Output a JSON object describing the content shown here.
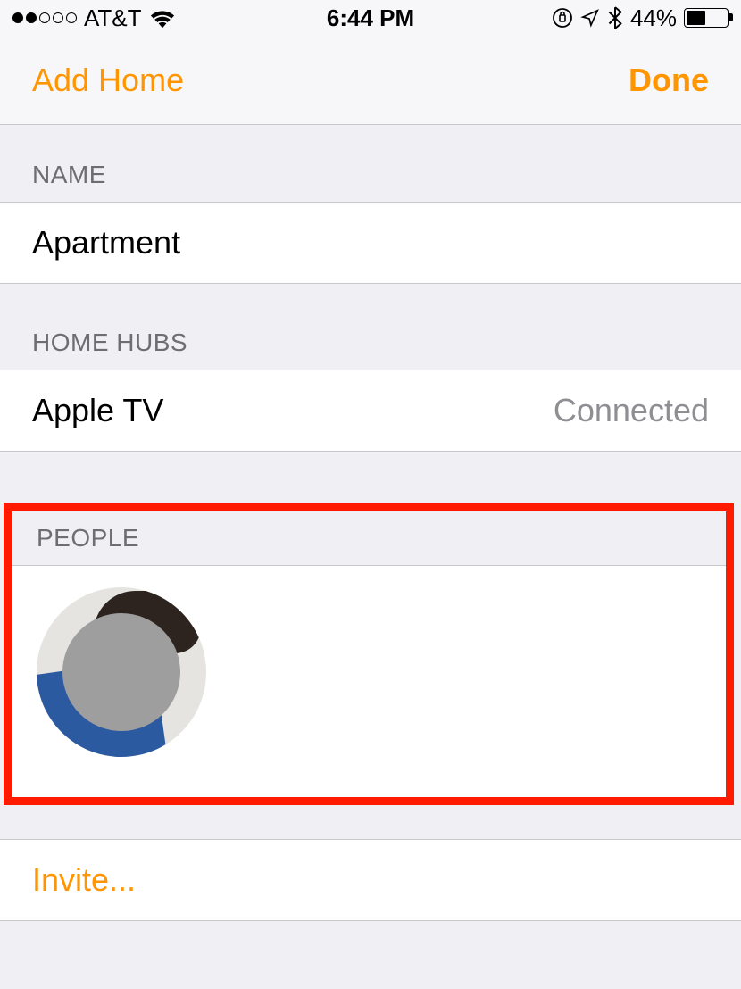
{
  "status_bar": {
    "carrier": "AT&T",
    "time": "6:44 PM",
    "battery_percent": "44%",
    "battery_fill_percent": 44
  },
  "nav": {
    "left_label": "Add Home",
    "right_label": "Done"
  },
  "sections": {
    "name": {
      "header": "NAME",
      "value": "Apartment"
    },
    "home_hubs": {
      "header": "HOME HUBS",
      "device": "Apple TV",
      "status": "Connected"
    },
    "people": {
      "header": "PEOPLE"
    },
    "invite": {
      "label": "Invite..."
    }
  }
}
